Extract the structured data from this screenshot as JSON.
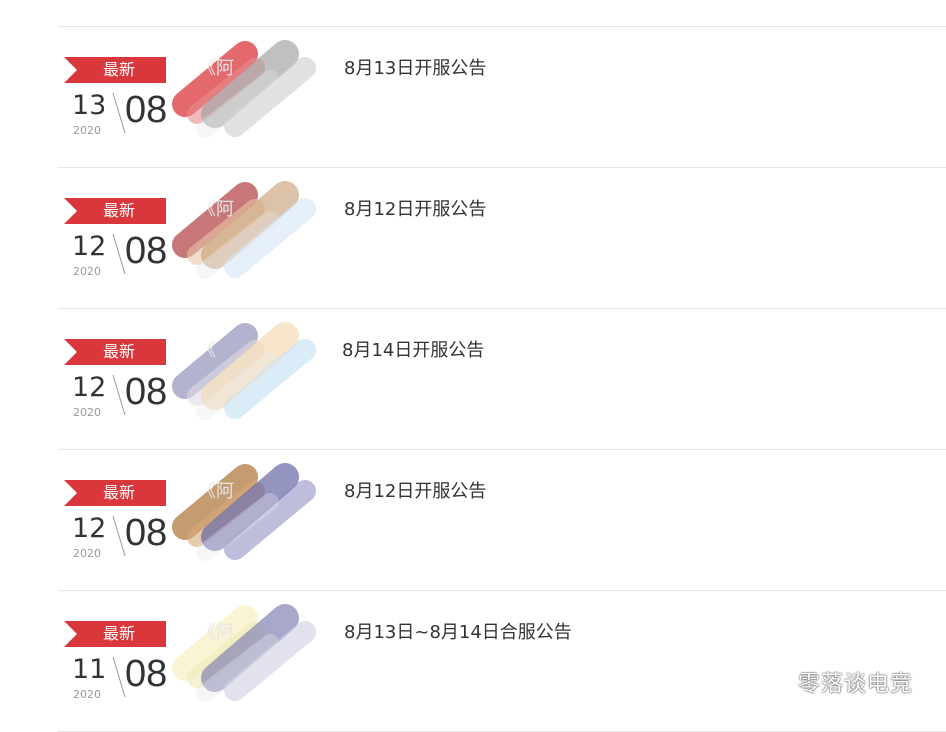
{
  "announcements": [
    {
      "badge": "最新",
      "day": "13",
      "year": "2020",
      "month": "08",
      "title_prefix": "《阿",
      "title_suffix": "8月13日开服公告",
      "smear": [
        "#d9373c",
        "#e98a8a"
      ],
      "smear2": [
        "#9e9e9e",
        "#c8c8c8"
      ]
    },
    {
      "badge": "最新",
      "day": "12",
      "year": "2020",
      "month": "08",
      "title_prefix": "《阿",
      "title_suffix": "8月12日开服公告",
      "smear": [
        "#b44a4a",
        "#e8c7a8"
      ],
      "smear2": [
        "#c9a27a",
        "#cfe3f5"
      ]
    },
    {
      "badge": "最新",
      "day": "12",
      "year": "2020",
      "month": "08",
      "title_prefix": "《",
      "title_suffix": "8月14日开服公告",
      "smear": [
        "#9a9abf",
        "#ded8e3"
      ],
      "smear2": [
        "#f2d8b0",
        "#bcdcf2"
      ]
    },
    {
      "badge": "最新",
      "day": "12",
      "year": "2020",
      "month": "08",
      "title_prefix": "《阿",
      "title_suffix": "8月12日开服公告",
      "smear": [
        "#b27a42",
        "#d6aa7a"
      ],
      "smear2": [
        "#5a5a9e",
        "#8a86bf"
      ]
    },
    {
      "badge": "最新",
      "day": "11",
      "year": "2020",
      "month": "08",
      "title_prefix": "《阿",
      "title_suffix": "8月13日~8月14日合服公告",
      "smear": [
        "#f6f0c6",
        "#efe9b5"
      ],
      "smear2": [
        "#7a7aae",
        "#c8cbe0"
      ]
    }
  ],
  "watermark": "零落谈电竞"
}
